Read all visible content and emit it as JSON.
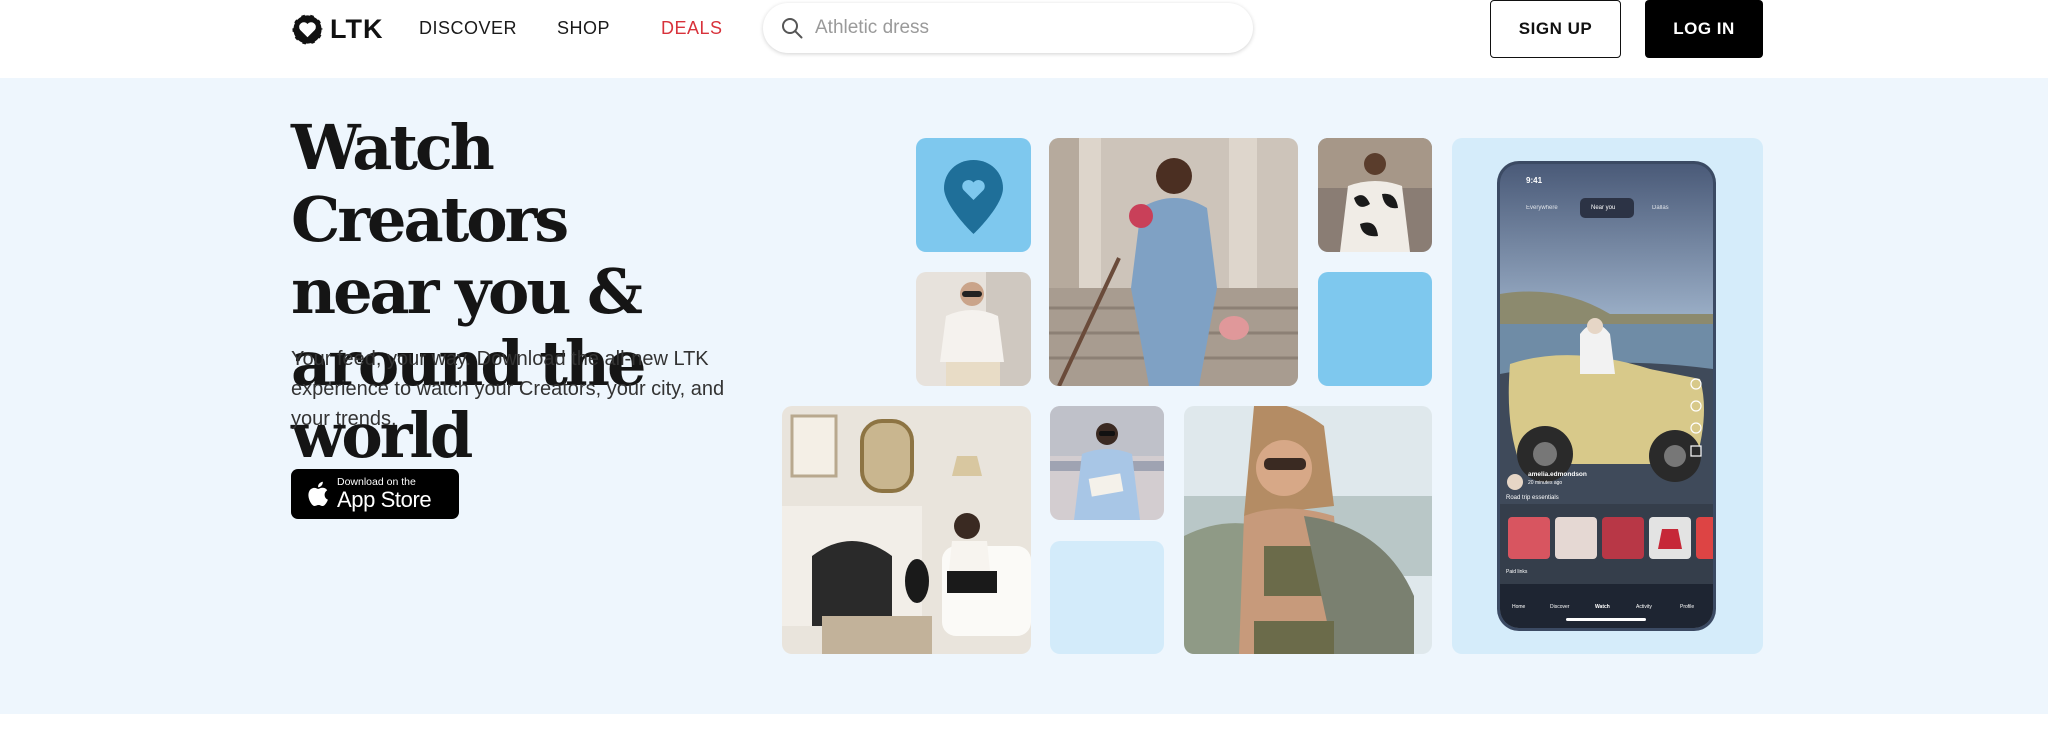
{
  "header": {
    "logo_text": "LTK",
    "nav": {
      "discover": "DISCOVER",
      "shop": "SHOP",
      "deals": "DEALS"
    },
    "search_placeholder": "Athletic dress",
    "signup_label": "SIGN UP",
    "login_label": "LOG IN"
  },
  "hero": {
    "title_lines": [
      "Watch Creators",
      "near you &",
      "around the world"
    ],
    "subtitle": "Your feed, your way. Download the all-new LTK experience to watch your Creators, your city, and your trends.",
    "appstore_small": "Download on the",
    "appstore_big": "App Store"
  },
  "phone": {
    "time": "9:41",
    "tabs": [
      "Everywhere",
      "Near you",
      "Dallas"
    ],
    "active_tab": "Near you",
    "creator": "amelia.edmondson",
    "posted": "20 minutes ago",
    "caption": "Road trip essentials",
    "paid_links": "Paid links",
    "bottom_nav": [
      "Home",
      "Discover",
      "Watch",
      "Activity",
      "Profile"
    ]
  },
  "colors": {
    "hero_bg": "#eef6fd",
    "accent_blue": "#7ec8ee",
    "light_blue": "#d3ebfa",
    "deals_red": "#d8323b"
  }
}
